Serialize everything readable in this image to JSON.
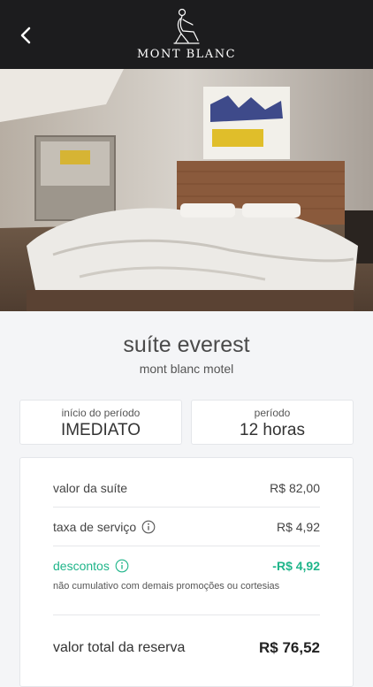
{
  "header": {
    "brand_name": "MONT BLANC"
  },
  "gallery": {
    "slide_count": 12,
    "active_index": 0
  },
  "suite": {
    "title": "suíte everest",
    "motel": "mont blanc motel"
  },
  "period_start": {
    "label": "início do período",
    "value": "IMEDIATO"
  },
  "period": {
    "label": "período",
    "value": "12 horas"
  },
  "summary": {
    "suite_value_label": "valor da suíte",
    "suite_value": "R$ 82,00",
    "service_fee_label": "taxa de serviço",
    "service_fee": "R$ 4,92",
    "discount_label": "descontos",
    "discount": "-R$ 4,92",
    "discount_note": "não cumulativo com demais promoções ou cortesias",
    "total_label": "valor total da reserva",
    "total": "R$ 76,52"
  },
  "colors": {
    "header_bg": "#1c1c1e",
    "discount_green": "#1fb58a",
    "page_bg": "#f4f5f7"
  },
  "icons": {
    "back": "chevron-left-icon",
    "info": "info-icon",
    "logo": "seated-figure-logo"
  }
}
